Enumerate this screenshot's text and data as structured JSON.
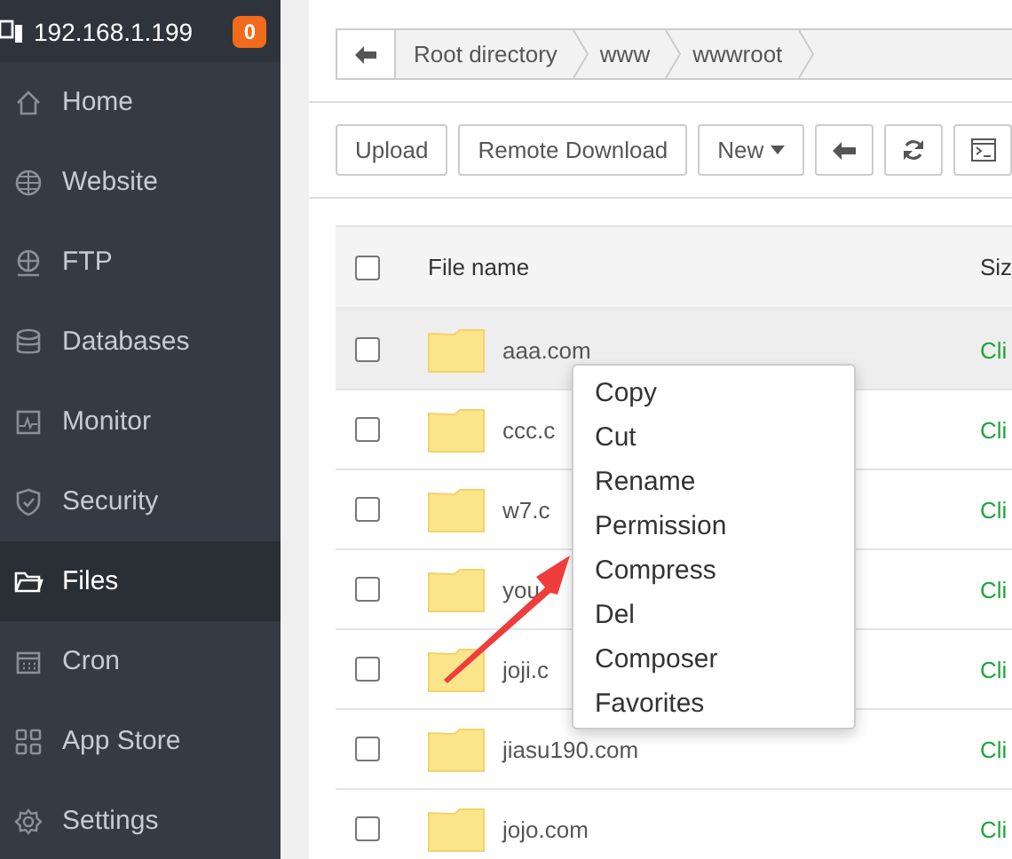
{
  "server": {
    "address": "192.168.1.199",
    "badge": "0"
  },
  "sidebar": {
    "items": [
      {
        "label": "Home",
        "selected": false
      },
      {
        "label": "Website",
        "selected": false
      },
      {
        "label": "FTP",
        "selected": false
      },
      {
        "label": "Databases",
        "selected": false
      },
      {
        "label": "Monitor",
        "selected": false
      },
      {
        "label": "Security",
        "selected": false
      },
      {
        "label": "Files",
        "selected": true
      },
      {
        "label": "Cron",
        "selected": false
      },
      {
        "label": "App Store",
        "selected": false
      },
      {
        "label": "Settings",
        "selected": false
      }
    ]
  },
  "breadcrumb": [
    "Root directory",
    "www",
    "wwwroot"
  ],
  "toolbar": {
    "buttons": [
      "Upload",
      "Remote Download",
      "New"
    ]
  },
  "table": {
    "columns": [
      "File name",
      "Siz"
    ],
    "header_checked": false,
    "rows": [
      {
        "name": "aaa.com",
        "column_2": "Cli",
        "checked": false,
        "highlighted": true
      },
      {
        "name": "ccc.c",
        "column_2": "Cli",
        "checked": false,
        "highlighted": false
      },
      {
        "name": "w7.c",
        "column_2": "Cli",
        "checked": false,
        "highlighted": false
      },
      {
        "name": "you",
        "column_2": "Cli",
        "checked": false,
        "highlighted": false
      },
      {
        "name": "joji.c",
        "column_2": "Cli",
        "checked": false,
        "highlighted": false
      },
      {
        "name": "jiasu190.com",
        "column_2": "Cli",
        "checked": false,
        "highlighted": false
      },
      {
        "name": "jojo.com",
        "column_2": "Cli",
        "checked": false,
        "highlighted": false
      }
    ]
  },
  "context_menu": {
    "items": [
      "Copy",
      "Cut",
      "Rename",
      "Permission",
      "Compress",
      "Del",
      "Composer",
      "Favorites"
    ]
  }
}
